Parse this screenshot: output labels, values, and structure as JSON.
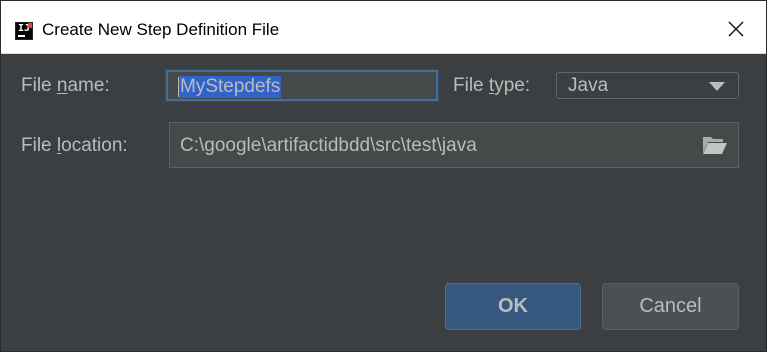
{
  "dialog": {
    "title": "Create New Step Definition File",
    "app_icon": "intellij-idea-icon",
    "close_icon": "close-icon"
  },
  "form": {
    "file_name": {
      "label_pre": "File ",
      "label_mnemonic": "n",
      "label_post": "ame:",
      "value": "MyStepdefs"
    },
    "file_type": {
      "label_pre": "File ",
      "label_mnemonic": "t",
      "label_post": "ype:",
      "selected": "Java",
      "icon": "chevron-down-icon"
    },
    "file_location": {
      "label_pre": "File ",
      "label_mnemonic": "l",
      "label_post": "ocation:",
      "value": "C:\\google\\artifactidbdd\\src\\test\\java",
      "icon": "folder-icon"
    }
  },
  "buttons": {
    "ok": "OK",
    "cancel": "Cancel"
  },
  "colors": {
    "background": "#3c3f41",
    "text": "#bbbbbb",
    "selection": "#2f65ca",
    "focus_border": "#466d94",
    "ok_button": "#365880"
  }
}
